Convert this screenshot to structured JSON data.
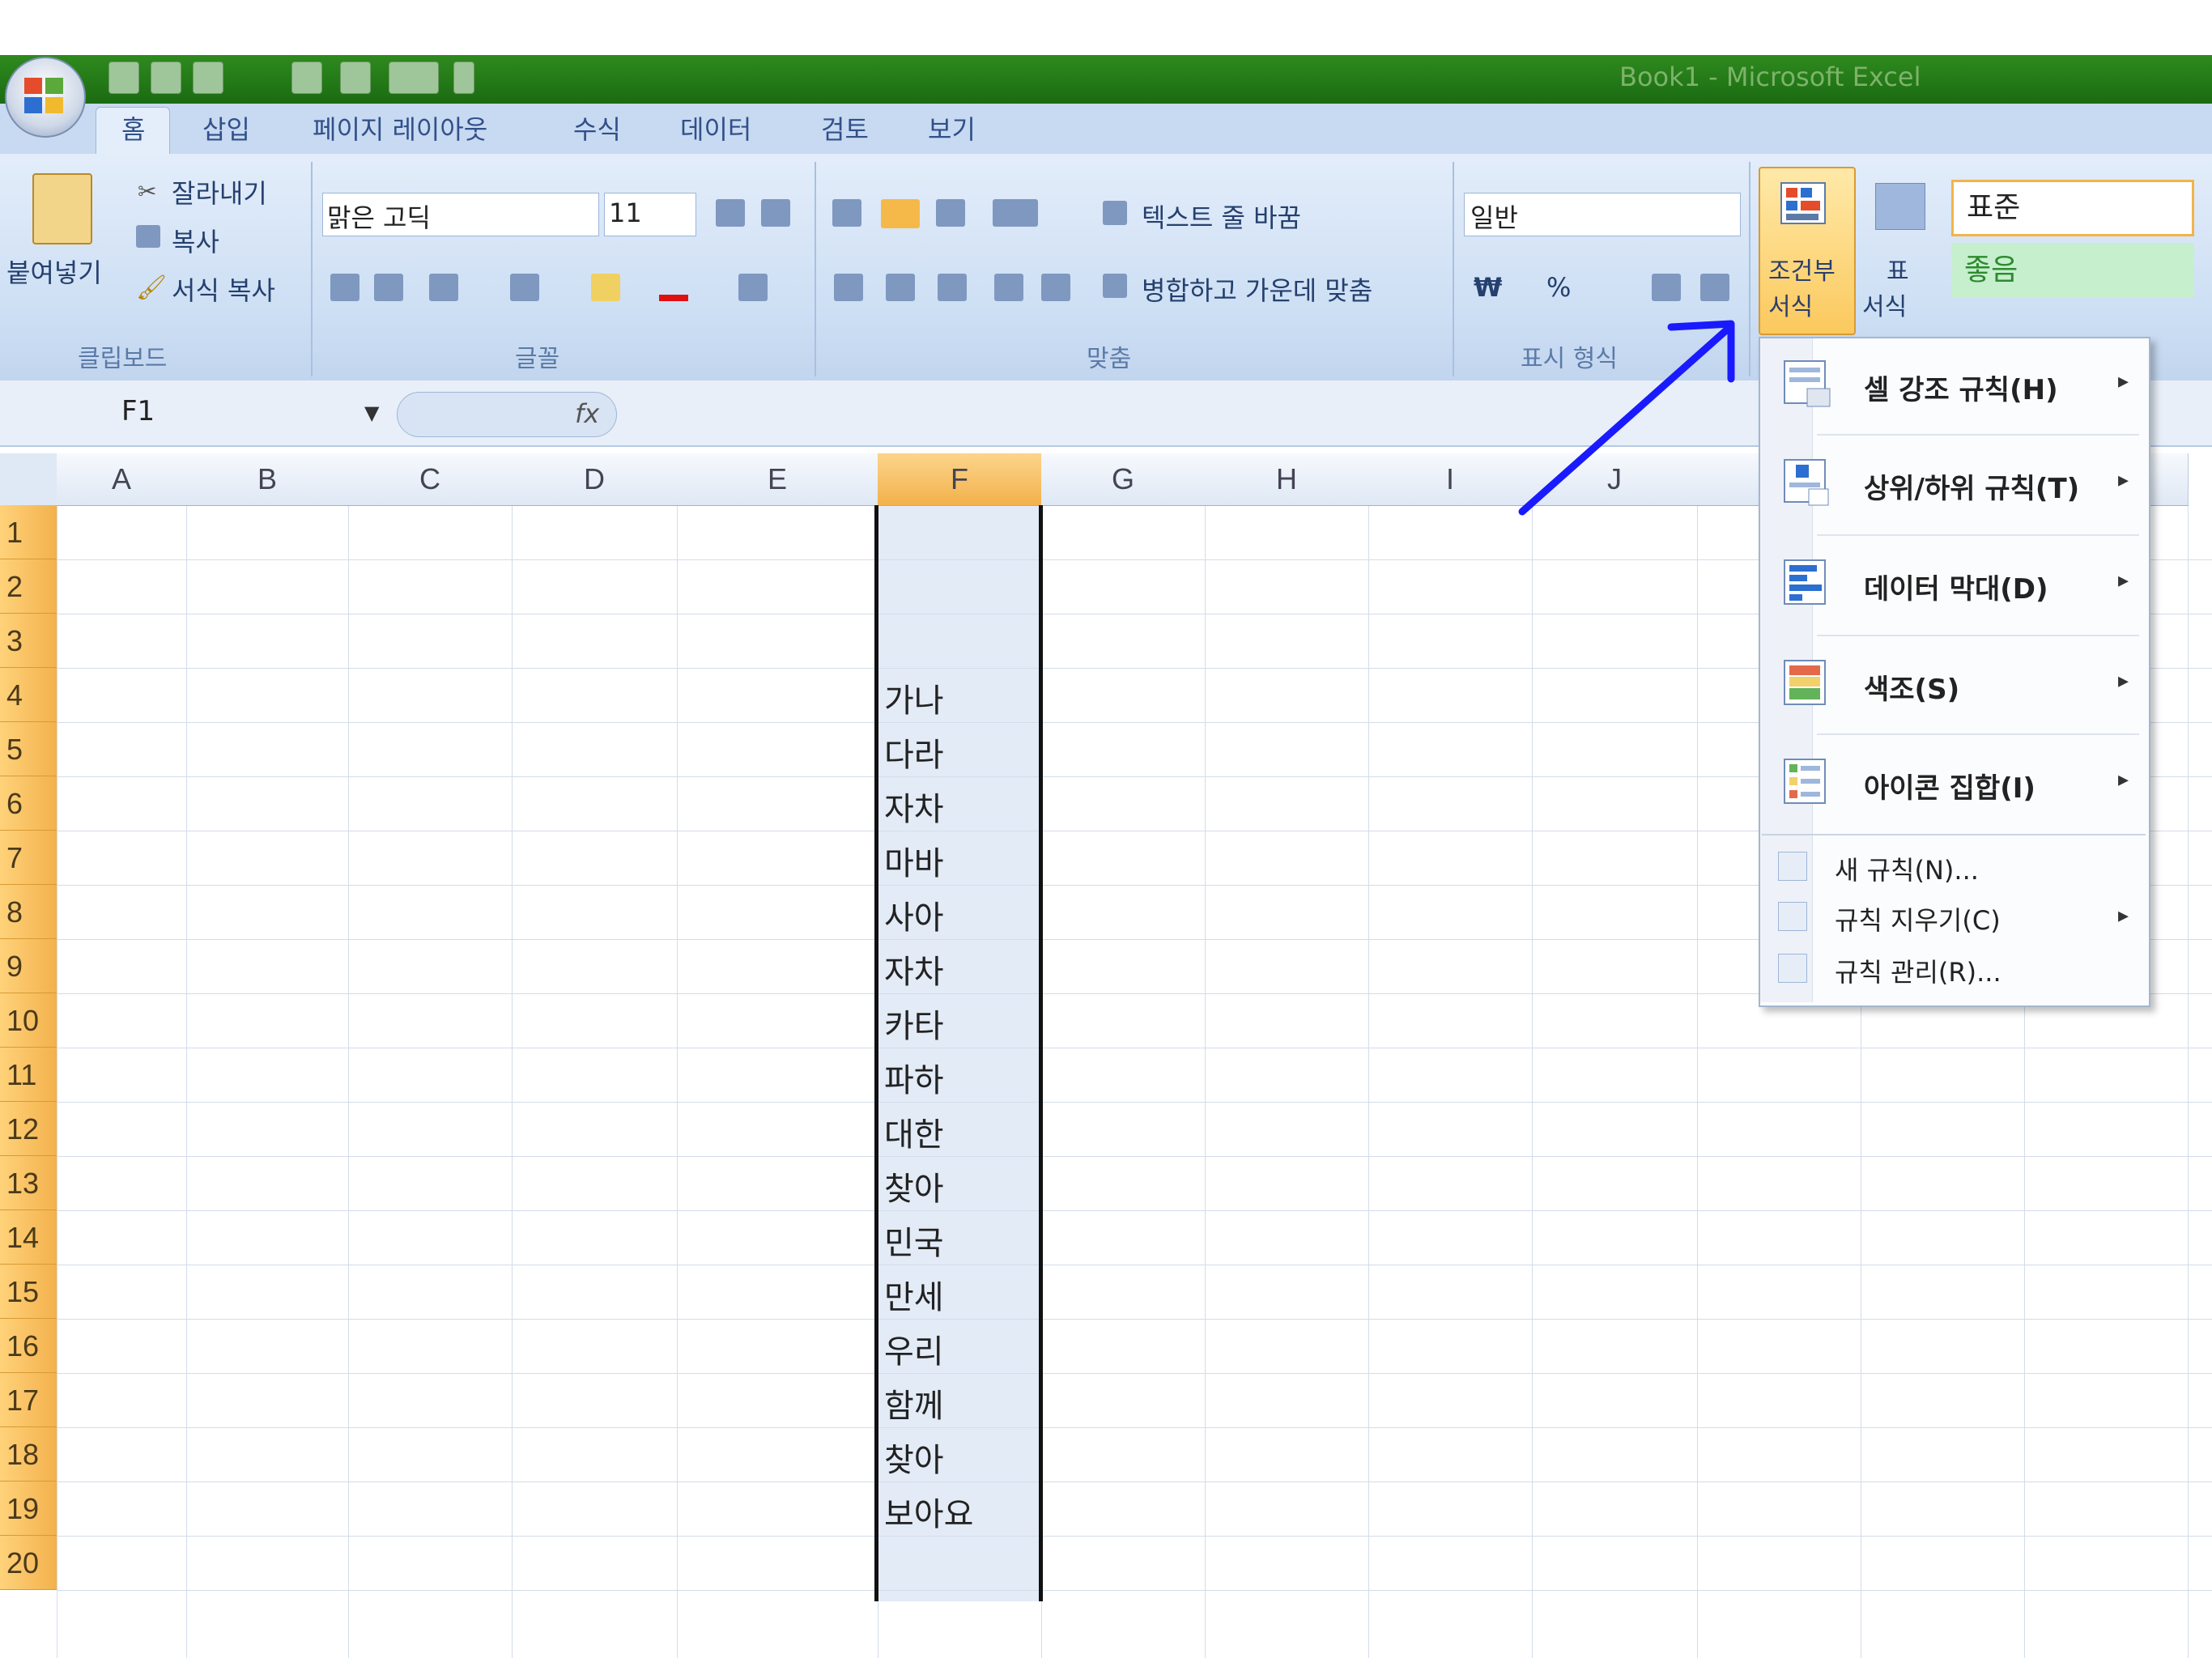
{
  "window": {
    "title": "Book1 - Microsoft Excel"
  },
  "tabs": [
    "홈",
    "삽입",
    "페이지 레이아웃",
    "수식",
    "데이터",
    "검토",
    "보기"
  ],
  "clipboard": {
    "paste": "붙여넣기",
    "cut": "잘라내기",
    "copy": "복사",
    "format_painter": "서식 복사",
    "group": "클립보드"
  },
  "font": {
    "name": "맑은 고딕",
    "size": "11",
    "group": "글꼴"
  },
  "alignment": {
    "wrap": "텍스트 줄 바꿈",
    "merge": "병합하고 가운데 맞춤",
    "group": "맞춤"
  },
  "number": {
    "format": "일반",
    "currency": "₩",
    "percent": "%",
    "group": "표시 형식"
  },
  "styles": {
    "conditional_formatting": [
      "조건부",
      "서식"
    ],
    "table_format": [
      "표",
      "서식"
    ],
    "normal": "표준",
    "good": "좋음"
  },
  "formula_bar": {
    "name_box": "F1",
    "fx": "fx"
  },
  "columns": [
    "A",
    "B",
    "C",
    "D",
    "E",
    "F",
    "G",
    "H",
    "I",
    "J"
  ],
  "rows": [
    "1",
    "2",
    "3",
    "4",
    "5",
    "6",
    "7",
    "8",
    "9",
    "10",
    "11",
    "12",
    "13",
    "14",
    "15",
    "16",
    "17",
    "18",
    "19",
    "20"
  ],
  "column_F": [
    "",
    "",
    "",
    "가나",
    "다라",
    "자차",
    "마바",
    "사아",
    "자차",
    "카타",
    "파하",
    "대한",
    "찾아",
    "민국",
    "만세",
    "우리",
    "함께",
    "찾아",
    "보아요",
    ""
  ],
  "cf_menu": {
    "highlight_rules": "셀 강조 규칙(H)",
    "top_bottom_rules": "상위/하위 규칙(T)",
    "data_bars": "데이터 막대(D)",
    "color_scales": "색조(S)",
    "icon_sets": "아이콘 집합(I)",
    "new_rule": "새 규칙(N)...",
    "clear_rules": "규칙 지우기(C)",
    "manage_rules": "규칙 관리(R)..."
  },
  "colors": {
    "title_bar": "#2e8a1e",
    "ribbon": "#cddff4",
    "row_header": "#f3b14c",
    "annotation_arrow": "#1a1aff"
  }
}
